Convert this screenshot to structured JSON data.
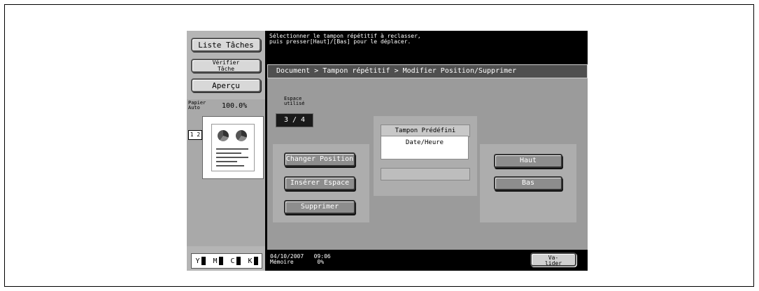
{
  "left": {
    "liste_taches": "Liste Tâches",
    "verifier_tache": "Vérifier\nTâche",
    "apercu": "Aperçu",
    "paper_label": "Papier\nAuto",
    "zoom": "100.0%",
    "page_indicator": "1 2",
    "toner": [
      "Y",
      "M",
      "C",
      "K"
    ]
  },
  "message": "Sélectionner le tampon répétitif à reclasser,\npuis presser[Haut]/[Bas] pour le déplacer.",
  "breadcrumb": "Document  >  Tampon répétitif > Modifier Position/Supprimer",
  "espace": {
    "label": "Espace\nutilisé",
    "value": "3  /  4"
  },
  "tampon": {
    "header": "Tampon Prédéfini",
    "value": "Date/Heure"
  },
  "buttons": {
    "changer_position": "Changer Position",
    "inserer_espace": "Insérer Espace",
    "supprimer": "Supprimer",
    "haut": "Haut",
    "bas": "Bas"
  },
  "footer": {
    "datetime": "04/10/2007   09:06\nMémoire       0%",
    "valider": "Va-\nlider"
  }
}
